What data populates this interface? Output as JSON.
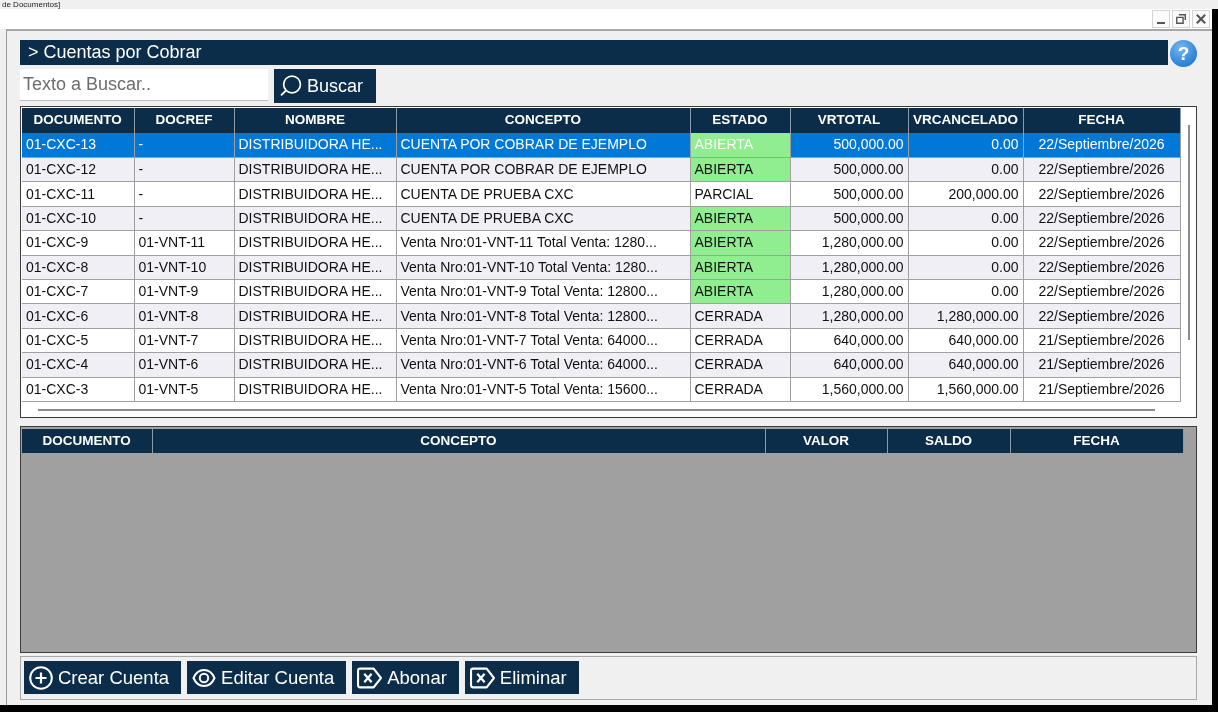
{
  "window": {
    "title": "de Documentos]"
  },
  "panel": {
    "title": "> Cuentas por Cobrar",
    "help_button": "?"
  },
  "search": {
    "placeholder": "Texto a Buscar..",
    "button": "Buscar"
  },
  "accounts_table": {
    "columns": [
      "DOCUMENTO",
      "DOCREF",
      "NOMBRE",
      "CONCEPTO",
      "ESTADO",
      "VRTOTAL",
      "VRCANCELADO",
      "FECHA"
    ],
    "rows": [
      {
        "cells": [
          "01-CXC-13",
          "-",
          "DISTRIBUIDORA HE...",
          "CUENTA POR COBRAR DE EJEMPLO",
          "ABIERTA",
          "500,000.00",
          "0.00",
          "22/Septiembre/2026"
        ],
        "selected": true,
        "status_highlighted": true
      },
      {
        "cells": [
          "01-CXC-12",
          "-",
          "DISTRIBUIDORA HE...",
          "CUENTA POR COBRAR DE EJEMPLO",
          "ABIERTA",
          "500,000.00",
          "0.00",
          "22/Septiembre/2026"
        ],
        "selected": false,
        "status_highlighted": true
      },
      {
        "cells": [
          "01-CXC-11",
          "-",
          "DISTRIBUIDORA HE...",
          "CUENTA DE PRUEBA CXC",
          "PARCIAL",
          "500,000.00",
          "200,000.00",
          "22/Septiembre/2026"
        ],
        "selected": false,
        "status_highlighted": false
      },
      {
        "cells": [
          "01-CXC-10",
          "-",
          "DISTRIBUIDORA HE...",
          "CUENTA DE PRUEBA CXC",
          "ABIERTA",
          "500,000.00",
          "0.00",
          "22/Septiembre/2026"
        ],
        "selected": false,
        "status_highlighted": true
      },
      {
        "cells": [
          "01-CXC-9",
          "01-VNT-11",
          "DISTRIBUIDORA HE...",
          "Venta Nro:01-VNT-11 Total Venta: 1280...",
          "ABIERTA",
          "1,280,000.00",
          "0.00",
          "22/Septiembre/2026"
        ],
        "selected": false,
        "status_highlighted": true
      },
      {
        "cells": [
          "01-CXC-8",
          "01-VNT-10",
          "DISTRIBUIDORA HE...",
          "Venta Nro:01-VNT-10 Total Venta: 1280...",
          "ABIERTA",
          "1,280,000.00",
          "0.00",
          "22/Septiembre/2026"
        ],
        "selected": false,
        "status_highlighted": true
      },
      {
        "cells": [
          "01-CXC-7",
          "01-VNT-9",
          "DISTRIBUIDORA HE...",
          "Venta Nro:01-VNT-9 Total Venta: 12800...",
          "ABIERTA",
          "1,280,000.00",
          "0.00",
          "22/Septiembre/2026"
        ],
        "selected": false,
        "status_highlighted": true
      },
      {
        "cells": [
          "01-CXC-6",
          "01-VNT-8",
          "DISTRIBUIDORA HE...",
          "Venta Nro:01-VNT-8 Total Venta: 12800...",
          "CERRADA",
          "1,280,000.00",
          "1,280,000.00",
          "22/Septiembre/2026"
        ],
        "selected": false,
        "status_highlighted": false
      },
      {
        "cells": [
          "01-CXC-5",
          "01-VNT-7",
          "DISTRIBUIDORA HE...",
          "Venta Nro:01-VNT-7 Total Venta: 64000...",
          "CERRADA",
          "640,000.00",
          "640,000.00",
          "21/Septiembre/2026"
        ],
        "selected": false,
        "status_highlighted": false
      },
      {
        "cells": [
          "01-CXC-4",
          "01-VNT-6",
          "DISTRIBUIDORA HE...",
          "Venta Nro:01-VNT-6 Total Venta: 64000...",
          "CERRADA",
          "640,000.00",
          "640,000.00",
          "21/Septiembre/2026"
        ],
        "selected": false,
        "status_highlighted": false
      },
      {
        "cells": [
          "01-CXC-3",
          "01-VNT-5",
          "DISTRIBUIDORA HE...",
          "Venta Nro:01-VNT-5 Total Venta: 15600...",
          "CERRADA",
          "1,560,000.00",
          "1,560,000.00",
          "21/Septiembre/2026"
        ],
        "selected": false,
        "status_highlighted": false
      }
    ]
  },
  "payments_table": {
    "columns": [
      "DOCUMENTO",
      "CONCEPTO",
      "VALOR",
      "SALDO",
      "FECHA"
    ]
  },
  "actions": [
    {
      "label": "Crear Cuenta",
      "kind": "add"
    },
    {
      "label": "Editar Cuenta",
      "kind": "view"
    },
    {
      "label": "Abonar",
      "kind": "clear"
    },
    {
      "label": "Eliminar",
      "kind": "clear"
    }
  ]
}
